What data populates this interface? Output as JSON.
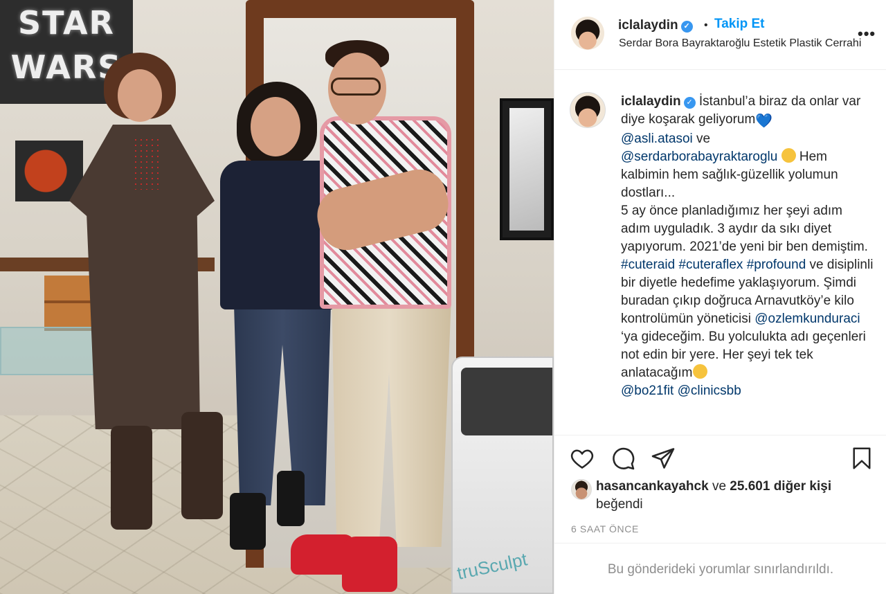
{
  "photo": {
    "sign_line1": "STAR",
    "sign_line2": "WARS",
    "machine_brand": "truSculpt"
  },
  "header": {
    "username": "iclalaydin",
    "verified_mark": "✓",
    "separator": "•",
    "follow_label": "Takip Et",
    "location": "Serdar Bora Bayraktaroğlu Estetik Plastik Cerrahi",
    "more_label": "•••"
  },
  "caption": {
    "username": "iclalaydin",
    "text_1": "İstanbul’a biraz da onlar var diye koşarak geliyorum",
    "emoji_heart": "💙",
    "mention_1": "@asli.atasoi",
    "text_2": " ve ",
    "mention_2": "@serdarborabayraktaroglu",
    "text_3": " Hem kalbimin hem sağlık-güzellik yolumun dostları...",
    "text_4": "5 ay önce planladığımız her şeyi adım adım uyguladık. 3 aydır da sıkı diyet yapıyorum. 2021’de yeni bir ben demiştim. ",
    "tag_1": "#cuteraid",
    "tag_2": "#cuteraflex",
    "tag_3": "#profound",
    "text_5": " ve disiplinli bir diyetle hedefime yaklaşıyorum. Şimdi buradan çıkıp doğruca Arnavutköy’e kilo kontrolümün yöneticisi ",
    "mention_3": "@ozlemkunduraci",
    "text_6": " ‘ya gideceğim. Bu yolculukta adı geçenleri not edin bir yere. Her şeyi tek tek anlatacağım",
    "mention_4": "@bo21fit",
    "mention_5": "@clinicsbb"
  },
  "actions": {
    "icons": [
      "heart-icon",
      "comment-icon",
      "share-icon",
      "bookmark-icon"
    ]
  },
  "likes": {
    "username": "hasancankayahck",
    "connector": " ve ",
    "count_text": "25.601 diğer kişi",
    "suffix": "beğendi"
  },
  "timestamp": "6 SAAT ÖNCE",
  "comments_restricted": "Bu gönderideki yorumlar sınırlandırıldı.",
  "colors": {
    "link": "#00376b",
    "follow": "#0095f6",
    "verified": "#3897f0",
    "muted": "#8e8e8e",
    "text": "#262626",
    "border": "#efefef"
  }
}
